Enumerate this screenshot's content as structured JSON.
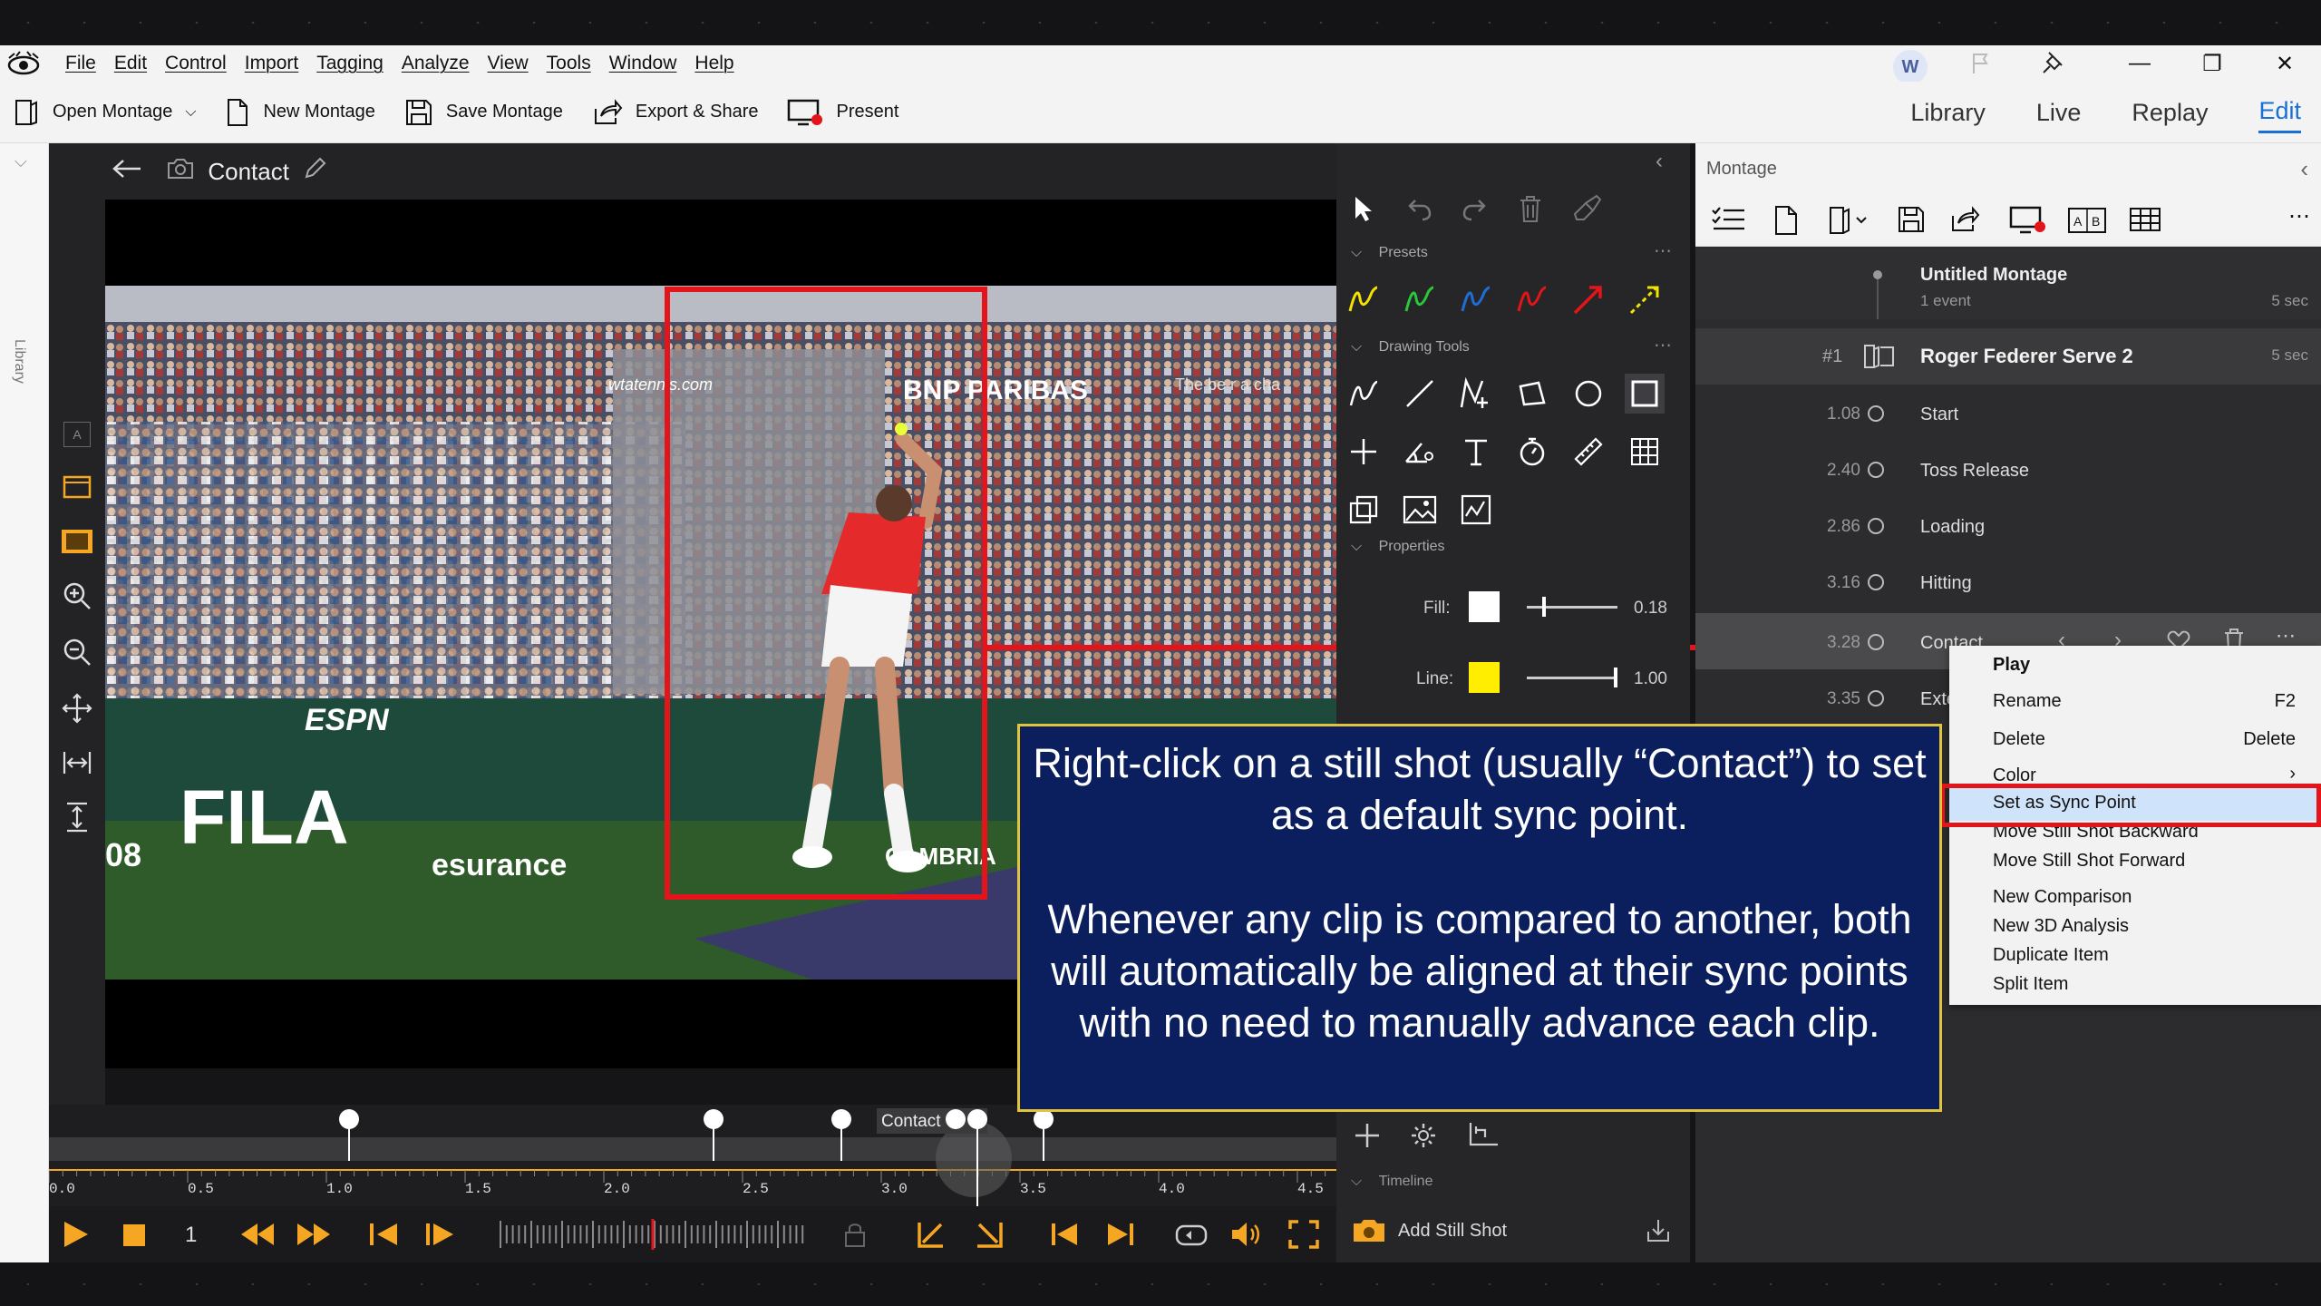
{
  "app": {
    "menu": [
      "File",
      "Edit",
      "Control",
      "Import",
      "Tagging",
      "Analyze",
      "View",
      "Tools",
      "Window",
      "Help"
    ],
    "avatar_initial": "W",
    "window_controls": [
      "—",
      "❐",
      "✕"
    ]
  },
  "toolbar": {
    "open_montage": "Open Montage",
    "new_montage": "New Montage",
    "save_montage": "Save Montage",
    "export_share": "Export & Share",
    "present": "Present"
  },
  "modes": {
    "library": "Library",
    "live": "Live",
    "replay": "Replay",
    "edit": "Edit"
  },
  "library_strip": {
    "label": "Library",
    "lane_a": "A"
  },
  "video": {
    "title": "Contact",
    "scene_text": {
      "fila": "FILA",
      "esurance": "esurance",
      "bnp": "BNP PARIBAS",
      "wta": "wtatennis.com",
      "cambria": "CAMBRIA",
      "espn": "ESPN",
      "ad_text": "The be     r a cha",
      "side_num": "08"
    }
  },
  "drawing_panel": {
    "presets_label": "Presets",
    "drawing_tools_label": "Drawing Tools",
    "properties_label": "Properties",
    "fill_label": "Fill:",
    "fill_value": "0.18",
    "line_label": "Line:",
    "line_value": "1.00",
    "timeline_label": "Timeline",
    "add_still_shot": "Add Still Shot",
    "fill_color": "#ffffff",
    "line_color": "#ffee00",
    "fill_level": 0.18,
    "line_level": 1.0
  },
  "montage": {
    "header": "Montage",
    "title": "Untitled Montage",
    "subtitle": "1 event",
    "duration": "5 sec",
    "clip_index": "#1",
    "clip_name": "Roger Federer Serve 2",
    "clip_duration": "5 sec",
    "rows": [
      {
        "time": "1.08",
        "name": "Start"
      },
      {
        "time": "2.40",
        "name": "Toss Release"
      },
      {
        "time": "2.86",
        "name": "Loading"
      },
      {
        "time": "3.16",
        "name": "Hitting"
      },
      {
        "time": "3.28",
        "name": "Contact"
      },
      {
        "time": "3.35",
        "name": "Exte"
      }
    ]
  },
  "context_menu": {
    "items": [
      {
        "label": "Play",
        "key": ""
      },
      {
        "label": "Rename",
        "key": "F2"
      },
      {
        "label": "Delete",
        "key": "Delete"
      },
      {
        "label": "Color",
        "key": "›"
      },
      {
        "label": "Set as Sync Point",
        "key": ""
      },
      {
        "label": "Move Still Shot Backward",
        "key": ""
      },
      {
        "label": "Move Still Shot Forward",
        "key": ""
      },
      {
        "label": "New Comparison",
        "key": ""
      },
      {
        "label": "New 3D Analysis",
        "key": ""
      },
      {
        "label": "Duplicate Item",
        "key": ""
      },
      {
        "label": "Split Item",
        "key": ""
      }
    ]
  },
  "timeline": {
    "marker_label": "Contact",
    "ticks": [
      "0.0",
      "0.5",
      "1.0",
      "1.5",
      "2.0",
      "2.5",
      "3.0",
      "3.5",
      "4.0",
      "4.5"
    ],
    "frame_step": "1"
  },
  "annotation": {
    "line1": "Right-click on a still shot (usually “Contact”) to set as a default sync point.",
    "line2": "Whenever any clip is compared to another, both will automatically be aligned at their sync points with no need to manually advance each clip."
  },
  "colors": {
    "accent": "#1a6fd6",
    "highlight_red": "#e3151a",
    "playback_orange": "#f5a623",
    "annotation_bg": "#0b1f5e",
    "annotation_border": "#e2c43a"
  }
}
